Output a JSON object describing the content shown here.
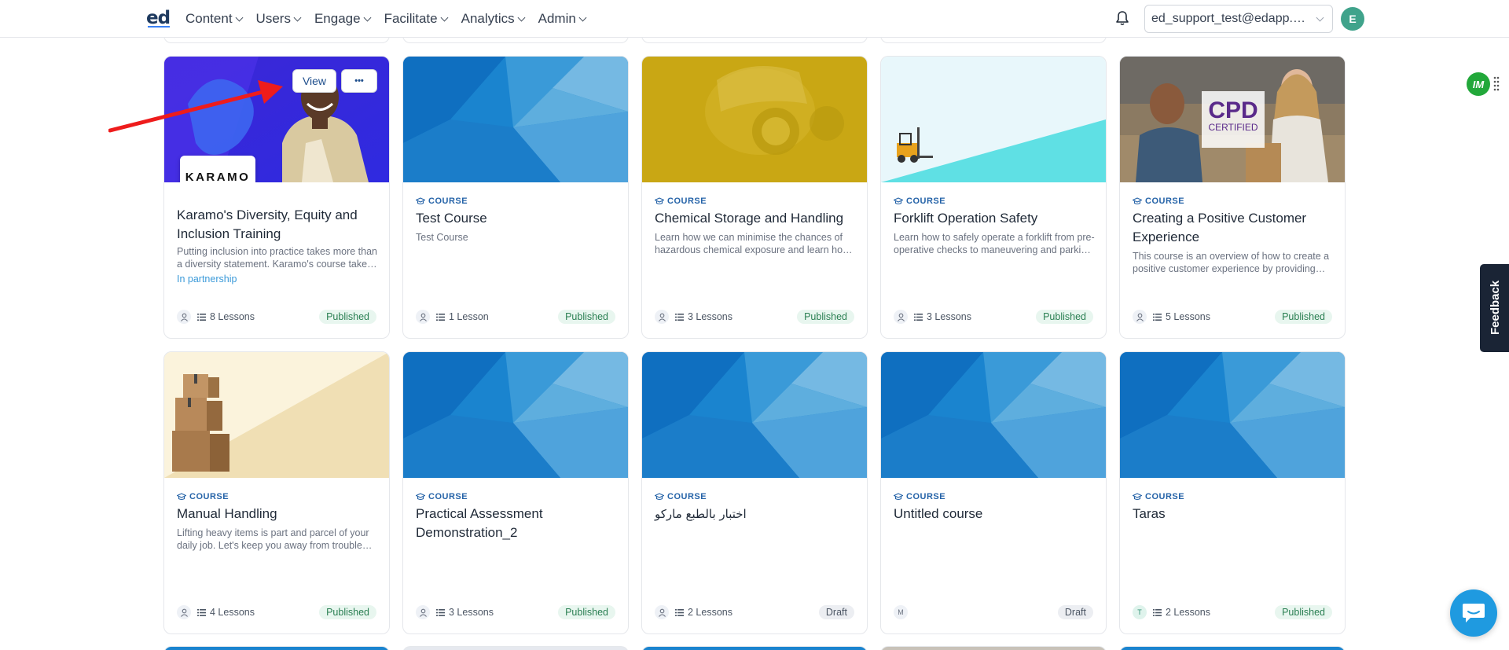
{
  "header": {
    "logo": "ed",
    "nav": [
      {
        "label": "Content"
      },
      {
        "label": "Users"
      },
      {
        "label": "Engage"
      },
      {
        "label": "Facilitate"
      },
      {
        "label": "Analytics"
      },
      {
        "label": "Admin"
      }
    ],
    "account": "ed_support_test@edapp.com",
    "avatar_initial": "E"
  },
  "hover_actions": {
    "view_label": "View",
    "more_label": "•••"
  },
  "cards": [
    {
      "title": "Karamo's Diversity, Equity and Inclusion Training",
      "type": "",
      "description": "Putting inclusion into practice takes more than a diversity statement. Karamo's course takes you through the steps to build an inclusive workplace.",
      "partner": "In partnership",
      "logo_text": "KARAMO",
      "lessons": "8 Lessons",
      "status": "Published",
      "owner": ""
    },
    {
      "title": "Test Course",
      "type": "COURSE",
      "description": "Test Course",
      "lessons": "1 Lesson",
      "status": "Published",
      "owner": ""
    },
    {
      "title": "Chemical Storage and Handling",
      "type": "COURSE",
      "description": "Learn how we can minimise the chances of hazardous chemical exposure and learn how to store and handle chemicals safely.",
      "lessons": "3 Lessons",
      "status": "Published",
      "owner": ""
    },
    {
      "title": "Forklift Operation Safety",
      "type": "COURSE",
      "description": "Learn how to safely operate a forklift from pre-operative checks to maneuvering and parking at the end of a shift.",
      "lessons": "3 Lessons",
      "status": "Published",
      "owner": ""
    },
    {
      "title": "Creating a Positive Customer Experience",
      "type": "COURSE",
      "description": "This course is an overview of how to create a positive customer experience by providing great service every time.",
      "cpd_text": "CPD",
      "cpd_sub": "CERTIFIED",
      "lessons": "5 Lessons",
      "status": "Published",
      "owner": ""
    },
    {
      "title": "Manual Handling",
      "type": "COURSE",
      "description": "Lifting heavy items is part and parcel of your daily job. Let's keep you away from trouble and injury with safe lifting techniques.",
      "lessons": "4 Lessons",
      "status": "Published",
      "owner": ""
    },
    {
      "title": "Practical Assessment Demonstration_2",
      "type": "COURSE",
      "description": "",
      "lessons": "3 Lessons",
      "status": "Published",
      "owner": ""
    },
    {
      "title": "اختبار بالطبع ماركو",
      "type": "COURSE",
      "description": "",
      "lessons": "2 Lessons",
      "status": "Draft",
      "owner": ""
    },
    {
      "title": "Untitled course",
      "type": "COURSE",
      "description": "",
      "lessons": "",
      "status": "Draft",
      "owner": "M"
    },
    {
      "title": "Taras",
      "type": "COURSE",
      "description": "",
      "lessons": "2 Lessons",
      "status": "Published",
      "owner": "T"
    }
  ],
  "widgets": {
    "im_badge": "IM",
    "feedback": "Feedback"
  },
  "colors": {
    "accent": "#2563a8",
    "published_bg": "#e8f6ef",
    "published_text": "#2a7f52",
    "draft_bg": "#eceef2",
    "arrow": "#ee1c1c"
  }
}
